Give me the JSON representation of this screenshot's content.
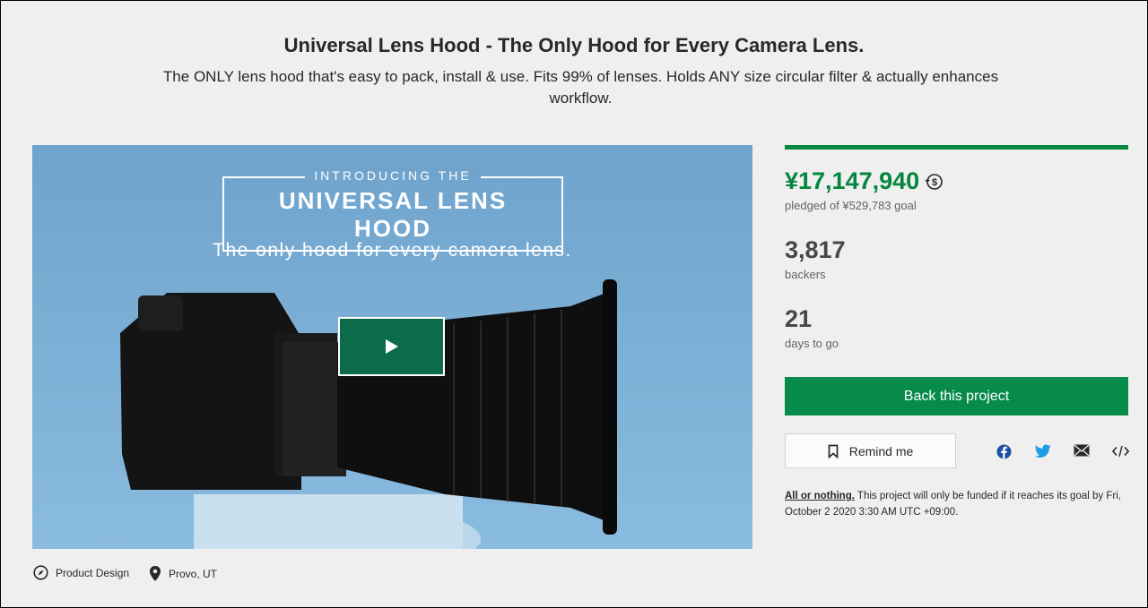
{
  "project": {
    "title": "Universal Lens Hood - The Only Hood for Every Camera Lens.",
    "blurb": "The ONLY lens hood that's easy to pack, install & use. Fits 99% of lenses. Holds ANY size circular filter & actually enhances workflow."
  },
  "video": {
    "intro_small": "INTRODUCING THE",
    "intro_title": "UNIVERSAL LENS HOOD",
    "tagline": "The only hood for every camera lens."
  },
  "meta": {
    "category": "Product Design",
    "location": "Provo, UT"
  },
  "stats": {
    "pledged": "¥17,147,940",
    "pledged_label": "pledged of ¥529,783 goal",
    "backers": "3,817",
    "backers_label": "backers",
    "days": "21",
    "days_label": "days to go",
    "progress_fraction": 1.0
  },
  "actions": {
    "back_label": "Back this project",
    "remind_label": "Remind me"
  },
  "share": [
    "facebook-icon",
    "twitter-icon",
    "email-icon",
    "embed-icon"
  ],
  "funding_note": {
    "link": "All or nothing.",
    "text": " This project will only be funded if it reaches its goal by Fri, October 2 2020 3:30 AM UTC +09:00."
  },
  "colors": {
    "accent": "#05863f",
    "button": "#078b4b",
    "play_bg": "#0c6b4a",
    "facebook": "#1d4fa3",
    "twitter": "#1c9be8"
  }
}
